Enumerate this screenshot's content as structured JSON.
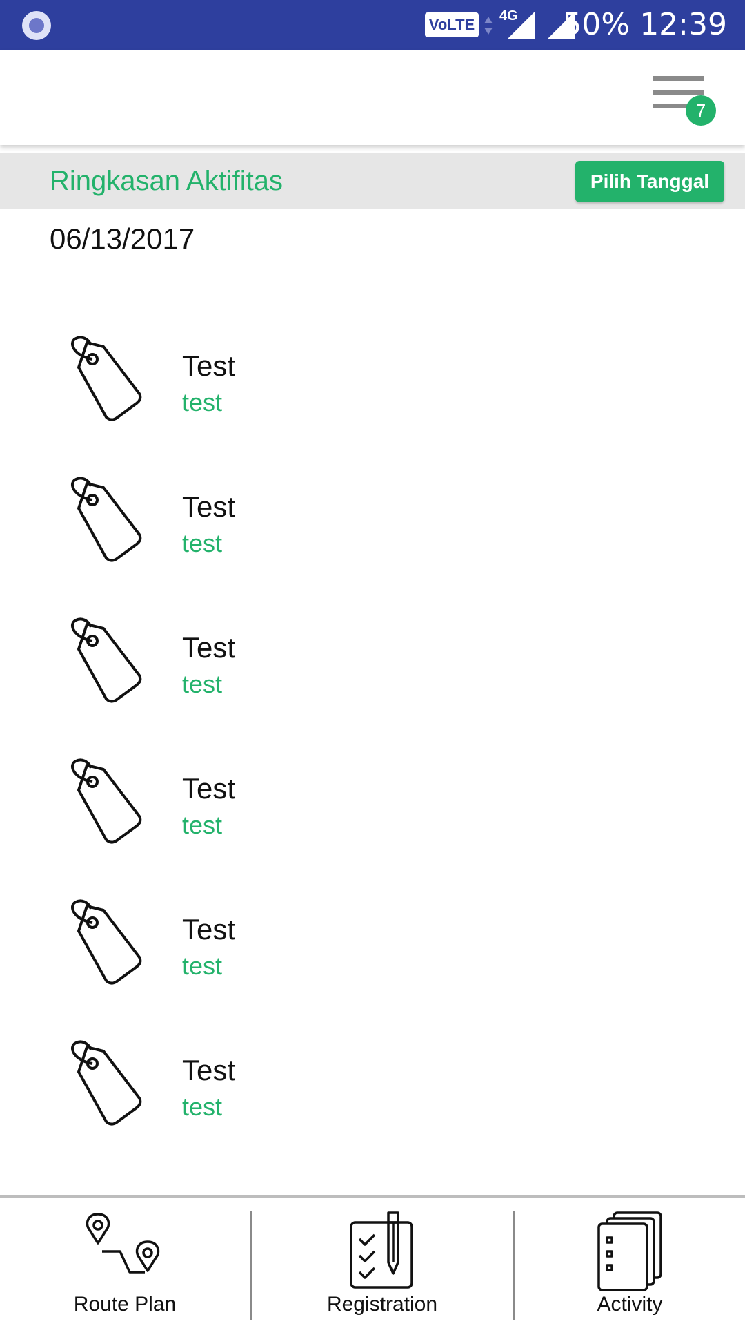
{
  "status_bar": {
    "network_badge": "VoLTE",
    "network_type": "4G",
    "battery": "50%",
    "time": "12:39"
  },
  "toolbar": {
    "menu_icon": "hamburger-icon",
    "notification_count": "7",
    "badge_color": "#23b26b"
  },
  "section": {
    "title": "Ringkasan Aktifitas",
    "pick_date_label": "Pilih Tanggal"
  },
  "selected_date": "06/13/2017",
  "activities": [
    {
      "title": "Test",
      "subtitle": "test",
      "icon": "tag-icon"
    },
    {
      "title": "Test",
      "subtitle": "test",
      "icon": "tag-icon"
    },
    {
      "title": "Test",
      "subtitle": "test",
      "icon": "tag-icon"
    },
    {
      "title": "Test",
      "subtitle": "test",
      "icon": "tag-icon"
    },
    {
      "title": "Test",
      "subtitle": "test",
      "icon": "tag-icon"
    },
    {
      "title": "Test",
      "subtitle": "test",
      "icon": "tag-icon"
    }
  ],
  "bottom_nav": [
    {
      "label": "Route Plan",
      "icon": "route-icon"
    },
    {
      "label": "Registration",
      "icon": "checklist-icon"
    },
    {
      "label": "Activity",
      "icon": "activity-cards-icon"
    }
  ],
  "colors": {
    "accent": "#23b26b",
    "status_bar": "#2e3f9e",
    "section_bg": "#e6e6e6"
  }
}
